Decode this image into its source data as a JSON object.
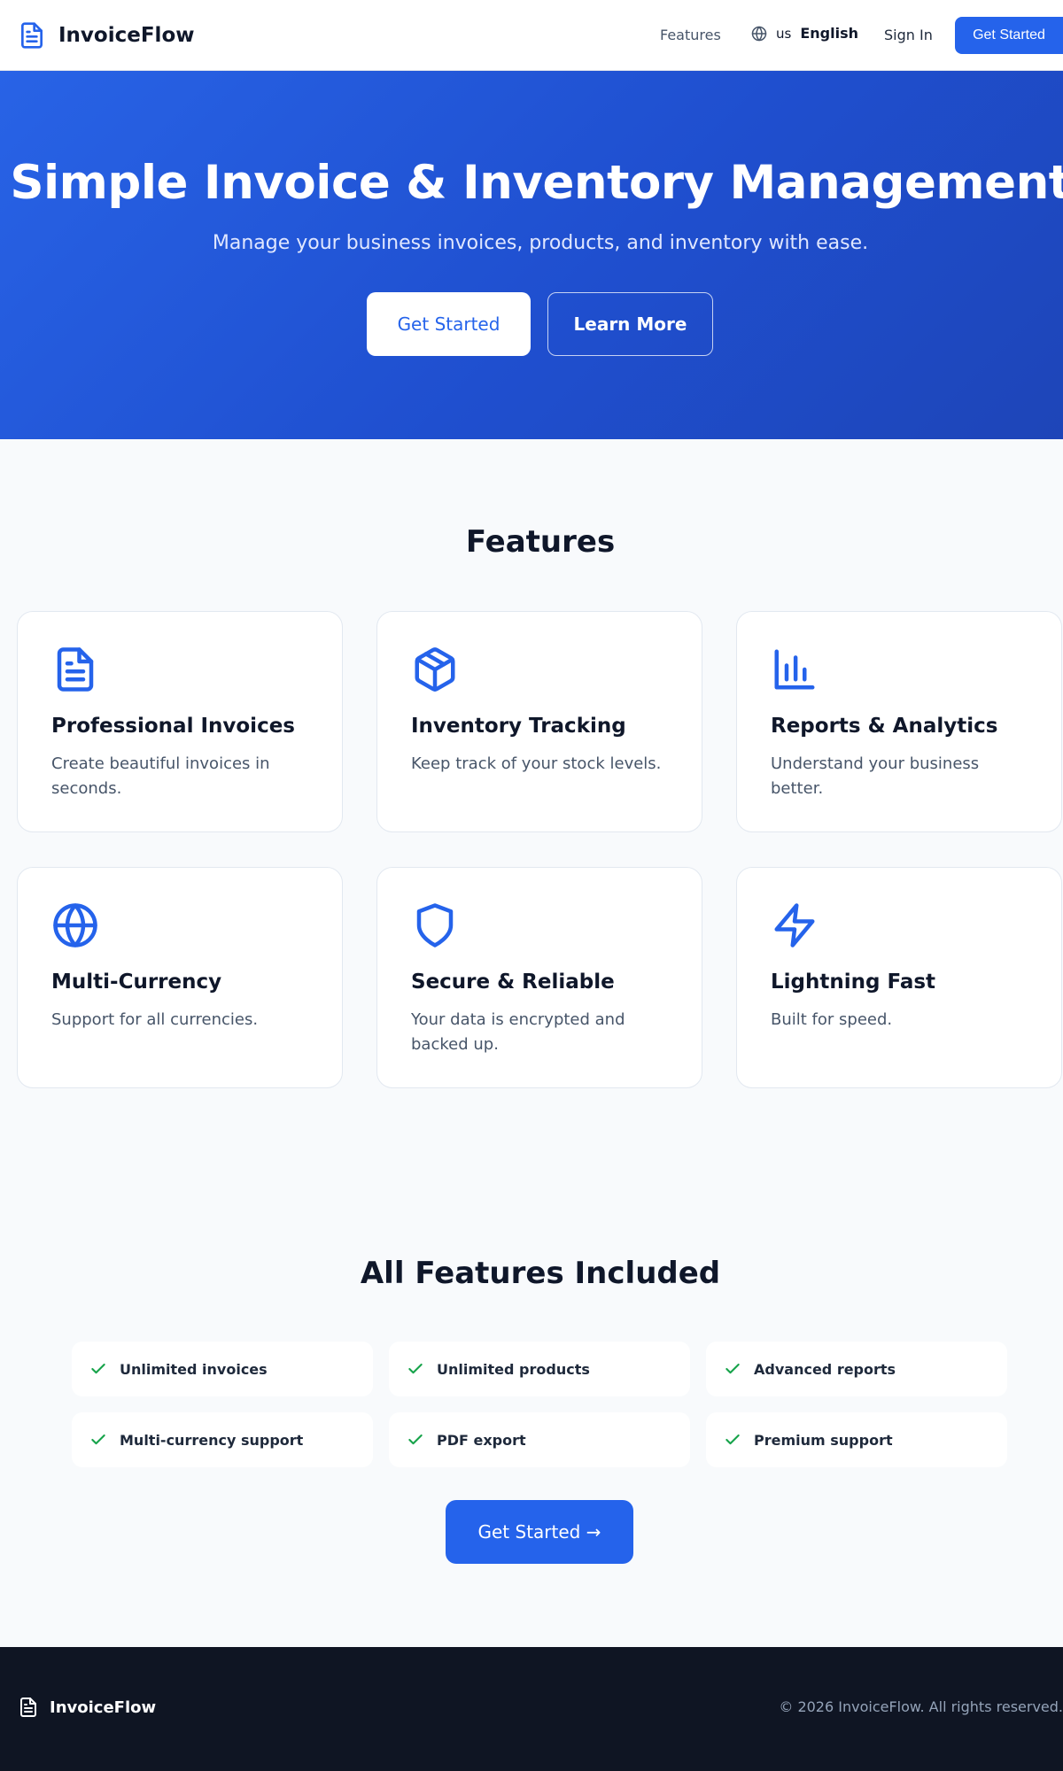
{
  "header": {
    "brand": "InvoiceFlow",
    "nav_features": "Features",
    "lang_code": "us",
    "lang_name": "English",
    "sign_in": "Sign In",
    "get_started": "Get Started",
    "icons": {
      "logo": "file-text-icon",
      "language": "globe-icon"
    }
  },
  "hero": {
    "title": "Simple Invoice & Inventory Management",
    "subtitle": "Manage your business invoices, products, and inventory with ease.",
    "primary_button": "Get Started",
    "secondary_button": "Learn More"
  },
  "features": {
    "title": "Features",
    "items": [
      {
        "icon": "file-text-icon",
        "title": "Professional Invoices",
        "desc": "Create beautiful invoices in seconds."
      },
      {
        "icon": "box-icon",
        "title": "Inventory Tracking",
        "desc": "Keep track of your stock levels."
      },
      {
        "icon": "bar-chart-icon",
        "title": "Reports & Analytics",
        "desc": "Understand your business better."
      },
      {
        "icon": "globe-icon",
        "title": "Multi-Currency",
        "desc": "Support for all currencies."
      },
      {
        "icon": "shield-icon",
        "title": "Secure & Reliable",
        "desc": "Your data is encrypted and backed up."
      },
      {
        "icon": "lightning-icon",
        "title": "Lightning Fast",
        "desc": "Built for speed."
      }
    ]
  },
  "included": {
    "title": "All Features Included",
    "items": [
      "Unlimited invoices",
      "Unlimited products",
      "Advanced reports",
      "Multi-currency support",
      "PDF export",
      "Premium support"
    ],
    "cta": "Get Started →"
  },
  "footer": {
    "brand": "InvoiceFlow",
    "copyright": "© 2026 InvoiceFlow. All rights reserved."
  },
  "colors": {
    "accent": "#2563eb",
    "check": "#16a34a",
    "footer_bg": "#0f1523"
  }
}
